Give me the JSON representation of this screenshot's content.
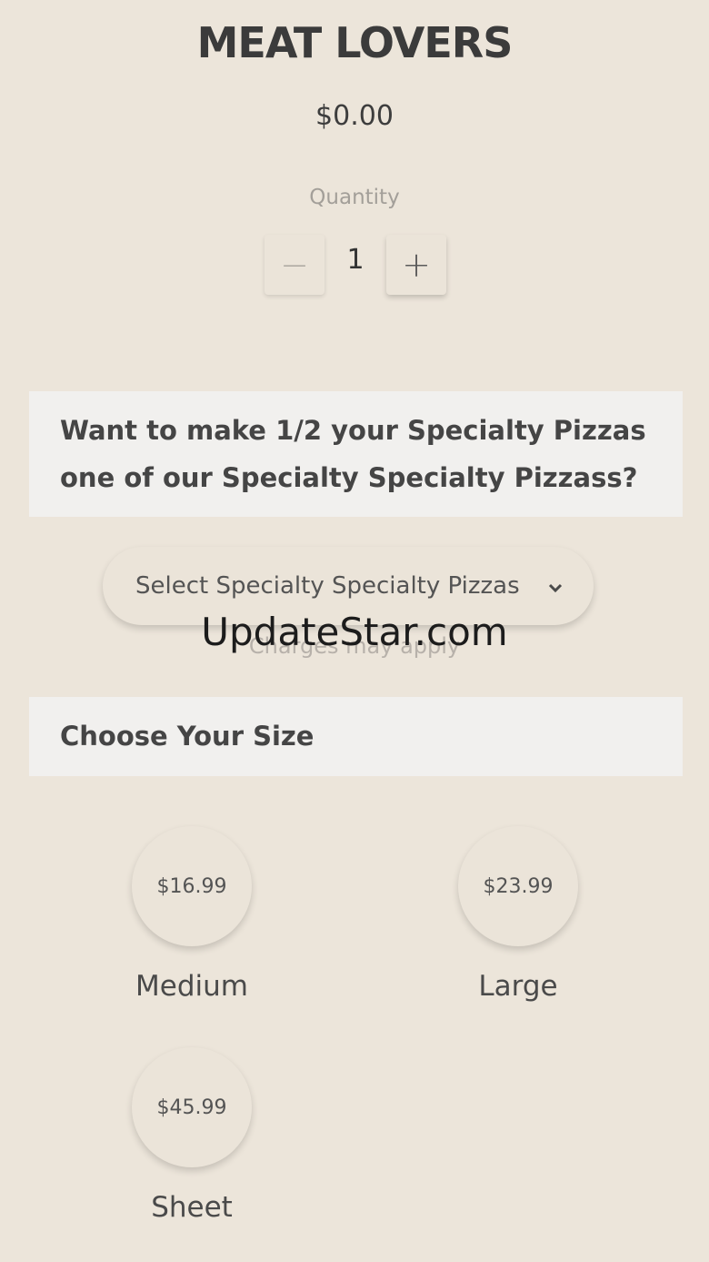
{
  "product": {
    "title": "MEAT LOVERS",
    "price": "$0.00"
  },
  "quantity": {
    "label": "Quantity",
    "value": "1",
    "decrement_symbol": "−",
    "increment_symbol": "+"
  },
  "half_section": {
    "heading_line1": "Want to make 1/2 your Specialty Pizzas",
    "heading_line2": "one of our Specialty Specialty Pizzass?",
    "select_value": "Select Specialty Specialty Pizzas",
    "select_icon": "chevron-down-icon",
    "note": "Charges may apply"
  },
  "watermark": "UpdateStar.com",
  "size_section": {
    "heading": "Choose Your Size",
    "options": [
      {
        "price": "$16.99",
        "label": "Medium"
      },
      {
        "price": "$23.99",
        "label": "Large"
      },
      {
        "price": "$45.99",
        "label": "Sheet"
      }
    ]
  }
}
